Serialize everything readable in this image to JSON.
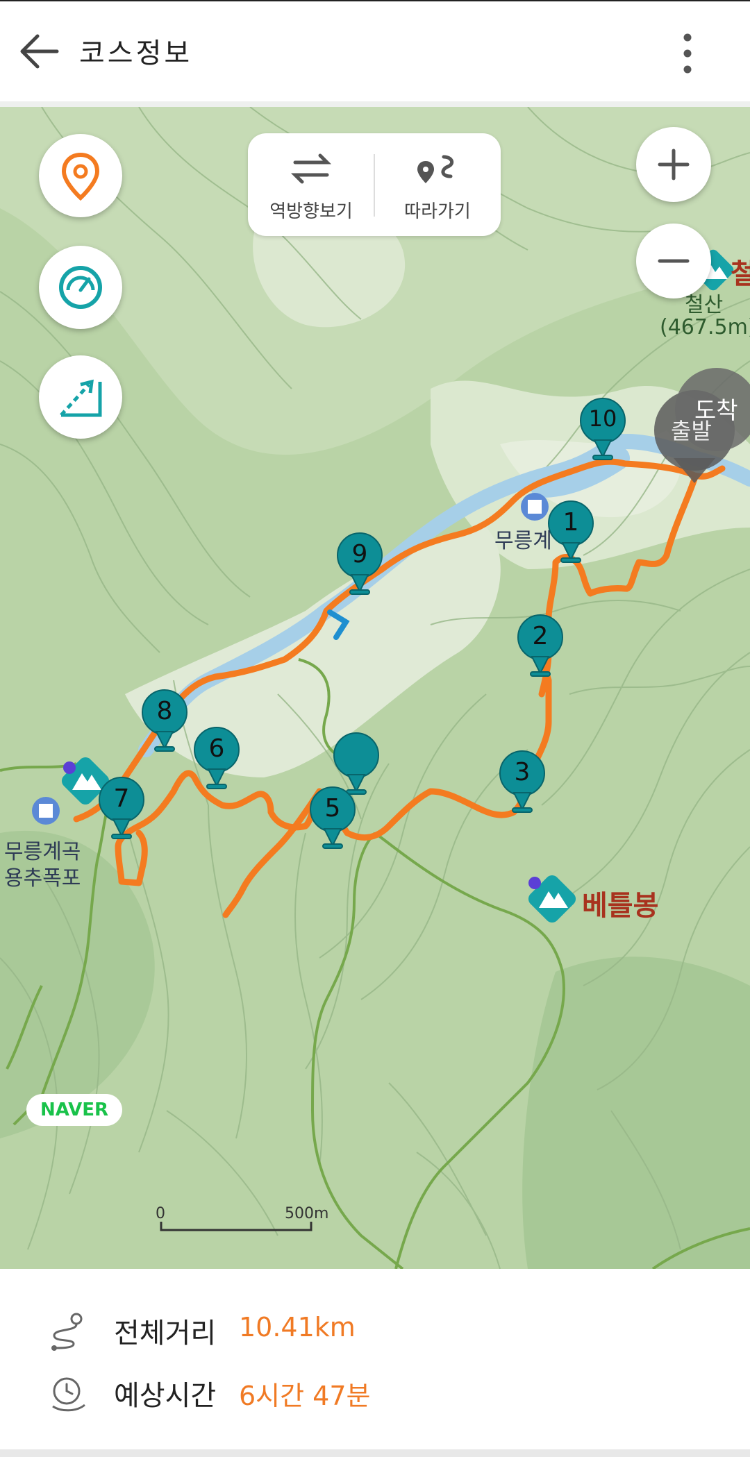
{
  "header": {
    "title": "코스정보"
  },
  "map_controls": {
    "reverse_label": "역방향보기",
    "follow_label": "따라가기"
  },
  "map": {
    "labels": {
      "valley_lower": "무릉계곡\n용추폭포",
      "valley_lower_line1": "무릉계곡",
      "valley_lower_line2": "용추폭포",
      "valley_upper": "무릉계",
      "peak_betteul": "베틀봉",
      "peak_cheolsan": "철산",
      "peak_cheolsan_elev": "(467.5m)",
      "peak_cheolsan_partial": "철",
      "start": "출발",
      "end": "도착"
    },
    "waypoints": [
      "1",
      "2",
      "3",
      "5",
      "6",
      "7",
      "8",
      "9",
      "10"
    ],
    "attribution": "NAVER",
    "scale": {
      "start": "0",
      "end": "500m"
    },
    "route_color": "#f47b20",
    "marker_color": "#0d8e96"
  },
  "course_info": {
    "distance_label": "전체거리",
    "distance_value": "10.41km",
    "time_label": "예상시간",
    "time_value": "6시간 47분",
    "accent_color": "#f07a24"
  }
}
